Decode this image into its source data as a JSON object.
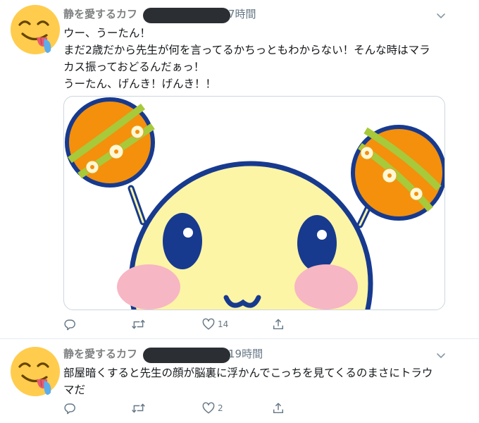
{
  "tweets": [
    {
      "name": "静を愛するカフ",
      "time": "7時間",
      "lines": [
        "ウー、うーたん！",
        "まだ2歳だから先生が何を言ってるかちっともわからない！そんな時はマラ",
        "カス振っておどるんだぁっ！",
        "うーたん、げんき！げんき！！"
      ],
      "reply_count": "",
      "retweet_count": "",
      "like_count": "14",
      "has_media": true
    },
    {
      "name": "静を愛するカフ",
      "time": "19時間",
      "lines": [
        "部屋暗くすると先生の顔が脳裏に浮かんでこっちを見てくるのまさにトラウ",
        "マだ"
      ],
      "reply_count": "",
      "retweet_count": "",
      "like_count": "2",
      "has_media": false
    }
  ],
  "icons": {
    "avatar": "savoring-food-emoji",
    "menu": "chevron-down-icon",
    "reply": "reply-icon",
    "retweet": "retweet-icon",
    "like": "heart-icon",
    "share": "share-icon"
  },
  "colors": {
    "text": "#14171a",
    "secondary": "#657786",
    "divider": "#e6ecf0",
    "character_face": "#fdf5a6",
    "character_outline": "#173a8f",
    "maraca": "#f4900c",
    "maraca_stripe": "#a8c93a",
    "cheek": "#f7b6c3"
  }
}
